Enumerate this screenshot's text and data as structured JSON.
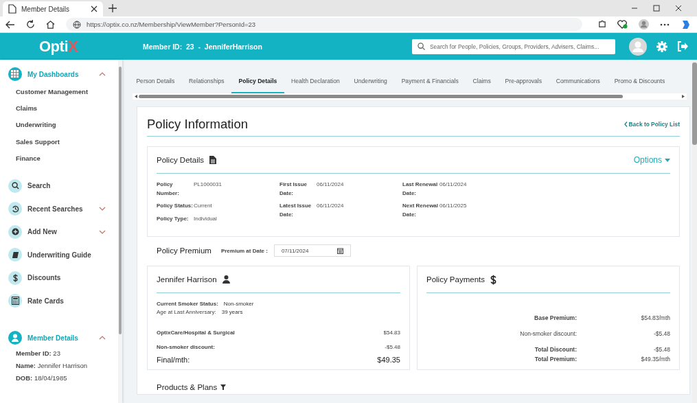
{
  "browser": {
    "tab_title": "Member Details",
    "url": "https://optix.co.nz/Membership/ViewMember?PersonId=23"
  },
  "header": {
    "logo_main": "Opti",
    "logo_accent": "X",
    "member": "Member ID:  23  -  JenniferHarrison",
    "search_placeholder": "Search for People, Policies, Groups, Providers, Advisers, Claims..."
  },
  "sidebar": {
    "dashboards": {
      "label": "My Dashboards",
      "expanded": true,
      "items": [
        "Customer Management",
        "Claims",
        "Underwriting",
        "Sales Support",
        "Finance"
      ]
    },
    "nav": [
      {
        "label": "Search",
        "kind": "link"
      },
      {
        "label": "Recent Searches",
        "kind": "group",
        "expanded": false
      },
      {
        "label": "Add New",
        "kind": "group",
        "expanded": false
      },
      {
        "label": "Underwriting Guide",
        "kind": "link"
      },
      {
        "label": "Discounts",
        "kind": "link"
      },
      {
        "label": "Rate Cards",
        "kind": "link"
      }
    ],
    "member_details": {
      "label": "Member Details",
      "expanded": true,
      "fields": [
        {
          "label": "Member ID:",
          "value": "23"
        },
        {
          "label": "Name:",
          "value": "Jennifer Harrison"
        },
        {
          "label": "DOB:",
          "value": "18/04/1985"
        }
      ]
    }
  },
  "tabs": [
    {
      "label": "Person Details",
      "selected": false
    },
    {
      "label": "Relationships",
      "selected": false
    },
    {
      "label": "Policy Details",
      "selected": true
    },
    {
      "label": "Health Declaration",
      "selected": false
    },
    {
      "label": "Underwriting",
      "selected": false
    },
    {
      "label": "Payment & Financials",
      "selected": false
    },
    {
      "label": "Claims",
      "selected": false
    },
    {
      "label": "Pre-approvals",
      "selected": false
    },
    {
      "label": "Communications",
      "selected": false
    },
    {
      "label": "Promo & Discounts",
      "selected": false
    }
  ],
  "page_title": "Policy Information",
  "back_link": "Back to Policy List",
  "policy_details": {
    "title": "Policy Details",
    "options": "Options",
    "columns": [
      [
        {
          "label": "Policy Number:",
          "value": "PL1000031"
        },
        {
          "label": "Policy Status:",
          "value": "Current"
        },
        {
          "label": "Policy Type:",
          "value": "Individual"
        }
      ],
      [
        {
          "label": "First Issue Date:",
          "value": "06/11/2024"
        },
        {
          "label": "Latest Issue Date:",
          "value": "06/11/2024"
        }
      ],
      [
        {
          "label": "Last Renewal Date:",
          "value": "06/11/2024"
        },
        {
          "label": "Next Renewal Date:",
          "value": "06/11/2025"
        }
      ]
    ]
  },
  "premium": {
    "title": "Policy Premium",
    "date_label": "Premium at Date :",
    "date_value": "07/11/2024"
  },
  "person": {
    "name": "Jennifer Harrison",
    "facts": [
      {
        "label": "Current Smoker Status:",
        "value": "Non-smoker",
        "bold": true
      },
      {
        "label": "Age at Last Anniversary:",
        "value": "39 years",
        "bold": false
      }
    ],
    "lines": [
      {
        "label": "OptixCare/Hospital & Surgical",
        "value": "$54.83"
      },
      {
        "label": "Non-smoker discount:",
        "value": "-$5.48"
      }
    ],
    "final_label": "Final/mth:",
    "final_value": "$49.35"
  },
  "payments": {
    "title": "Policy Payments",
    "rows": [
      {
        "label": "Base Premium:",
        "value": "$54.83/mth",
        "bold": true
      },
      {
        "label": "Non-smoker discount:",
        "value": "-$5.48",
        "bold": false
      },
      {
        "label": "Total Discount:",
        "value": "-$5.48",
        "bold": true
      },
      {
        "label": "Total Premium:",
        "value": "$49.35/mth",
        "bold": true
      }
    ]
  },
  "products_title": "Products & Plans"
}
